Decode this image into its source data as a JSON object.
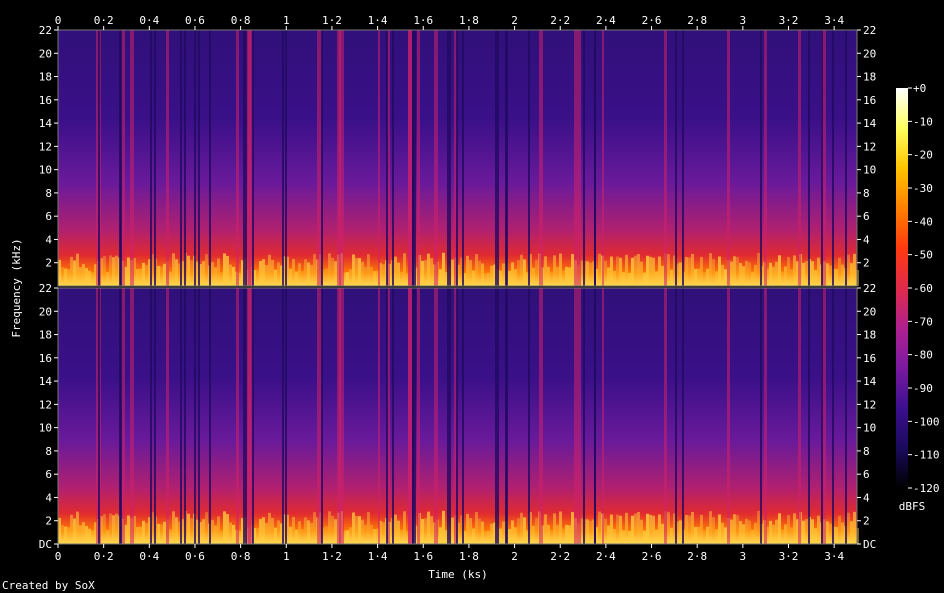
{
  "chart_data": {
    "type": "heatmap",
    "title": "",
    "xlabel": "Time (ks)",
    "ylabel": "Frequency (kHz)",
    "xlim": [
      0,
      3.5
    ],
    "ylim": [
      0,
      22
    ],
    "x_ticks": [
      "0",
      "0·2",
      "0·4",
      "0·6",
      "0·8",
      "1",
      "1·2",
      "1·4",
      "1·6",
      "1·8",
      "2",
      "2·2",
      "2·4",
      "2·6",
      "2·8",
      "3",
      "3·2",
      "3·4"
    ],
    "x_tick_values": [
      0,
      0.2,
      0.4,
      0.6,
      0.8,
      1,
      1.2,
      1.4,
      1.6,
      1.8,
      2,
      2.2,
      2.4,
      2.6,
      2.8,
      3,
      3.2,
      3.4
    ],
    "y_ticks_upper": [
      "22",
      "20",
      "18",
      "16",
      "14",
      "12",
      "10",
      "8",
      "6",
      "4",
      "2"
    ],
    "y_ticks_lower": [
      "22",
      "20",
      "18",
      "16",
      "14",
      "12",
      "10",
      "8",
      "6",
      "4",
      "2",
      "DC"
    ],
    "y_tick_values": [
      22,
      20,
      18,
      16,
      14,
      12,
      10,
      8,
      6,
      4,
      2,
      0
    ],
    "channels": 2,
    "colorbar": {
      "label": "dBFS",
      "range": [
        -120,
        0
      ],
      "ticks": [
        "+0",
        "-10",
        "-20",
        "-30",
        "-40",
        "-50",
        "-60",
        "-70",
        "-80",
        "-90",
        "-100",
        "-110",
        "-120"
      ],
      "tick_values": [
        0,
        -10,
        -20,
        -30,
        -40,
        -50,
        -60,
        -70,
        -80,
        -90,
        -100,
        -110,
        -120
      ],
      "colors": [
        "#000000",
        "#1a0a5c",
        "#3b0f8f",
        "#7a1aa0",
        "#b0208f",
        "#e02a4a",
        "#ff3a10",
        "#ff8000",
        "#ffc400",
        "#ffff60",
        "#ffffff"
      ]
    }
  },
  "footer": {
    "credit": "Created by SoX"
  }
}
